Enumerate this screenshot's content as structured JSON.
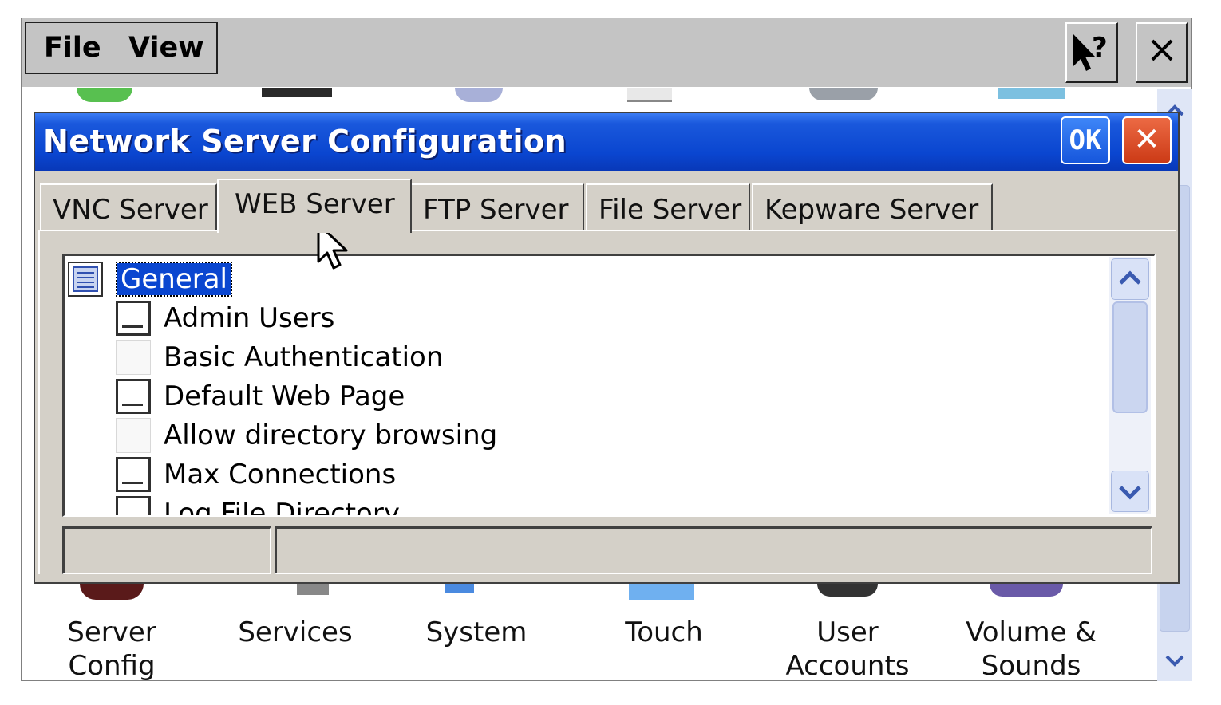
{
  "menu": {
    "file": "File",
    "view": "View"
  },
  "dialog": {
    "title": "Network Server Configuration",
    "ok_label": "OK",
    "close_label": "✕",
    "tabs": [
      {
        "label": "VNC Server",
        "active": false
      },
      {
        "label": "WEB Server",
        "active": true
      },
      {
        "label": "FTP Server",
        "active": false
      },
      {
        "label": "File Server",
        "active": false
      },
      {
        "label": "Kepware Server",
        "active": false
      }
    ],
    "tree": {
      "root": "General",
      "items": [
        {
          "label": "Admin Users",
          "icon": "leaf-box-icon"
        },
        {
          "label": "Basic Authentication",
          "icon": "checkbox-icon"
        },
        {
          "label": "Default Web Page",
          "icon": "leaf-box-icon"
        },
        {
          "label": "Allow directory browsing",
          "icon": "checkbox-icon"
        },
        {
          "label": "Max Connections",
          "icon": "leaf-box-icon"
        },
        {
          "label": "Log File Directory",
          "icon": "leaf-box-icon"
        }
      ]
    }
  },
  "control_panel": {
    "icons": [
      {
        "label": "Server\nConfig"
      },
      {
        "label": "Services"
      },
      {
        "label": "System"
      },
      {
        "label": "Touch"
      },
      {
        "label": "User\nAccounts"
      },
      {
        "label": "Volume &\nSounds"
      }
    ]
  },
  "colors": {
    "titlebar": "#0a46d0",
    "dialog_bg": "#d4d0c8",
    "selection": "#0a46d0"
  }
}
